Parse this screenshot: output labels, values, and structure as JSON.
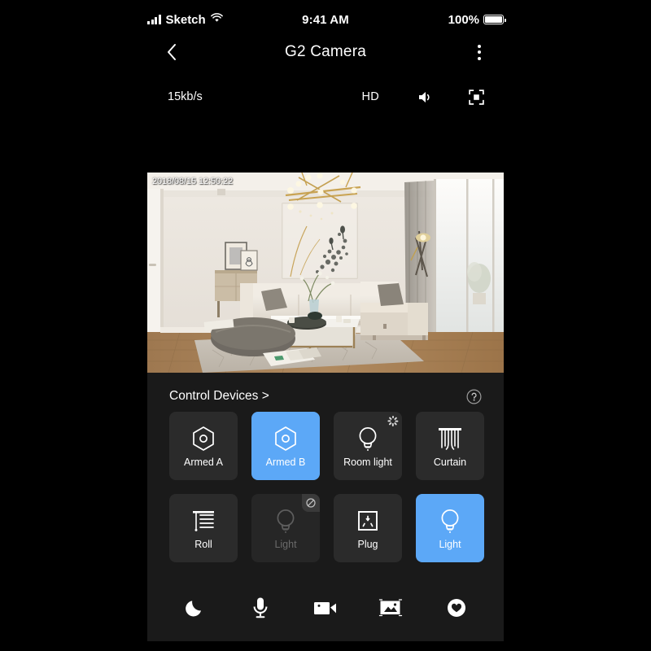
{
  "status_bar": {
    "carrier": "Sketch",
    "time": "9:41 AM",
    "battery_percent": "100%",
    "signal_icon": "signal-bars-icon",
    "wifi_icon": "wifi-icon",
    "battery_icon": "battery-full-icon"
  },
  "nav": {
    "back_icon": "chevron-left-icon",
    "title": "G2 Camera",
    "menu_icon": "more-vertical-icon"
  },
  "quality_bar": {
    "bitrate": "15kb/s",
    "quality": "HD",
    "speaker_icon": "speaker-on-icon",
    "fullscreen_icon": "fullscreen-icon"
  },
  "video": {
    "timestamp": "2018/08/15 12:50:22",
    "scene": "living-room"
  },
  "control_section": {
    "title": "Control Devices >",
    "help_icon": "help-circle-icon",
    "devices": [
      {
        "label": "Armed A",
        "icon": "shield-hexagon-icon",
        "state": "off",
        "badge": "none"
      },
      {
        "label": "Armed B",
        "icon": "shield-hexagon-icon",
        "state": "active",
        "badge": "none"
      },
      {
        "label": "Room light",
        "icon": "bulb-icon",
        "state": "off",
        "badge": "loading"
      },
      {
        "label": "Curtain",
        "icon": "curtain-icon",
        "state": "off",
        "badge": "none"
      },
      {
        "label": "Roll",
        "icon": "roller-blind-icon",
        "state": "off",
        "badge": "none"
      },
      {
        "label": "Light",
        "icon": "bulb-icon",
        "state": "disabled",
        "badge": "offline"
      },
      {
        "label": "Plug",
        "icon": "power-socket-icon",
        "state": "off",
        "badge": "none"
      },
      {
        "label": "Light",
        "icon": "bulb-icon",
        "state": "active",
        "badge": "none"
      }
    ]
  },
  "toolbar": {
    "items": [
      {
        "icon": "moon-icon",
        "name": "night-mode-button"
      },
      {
        "icon": "microphone-icon",
        "name": "talk-button"
      },
      {
        "icon": "video-camera-icon",
        "name": "record-button"
      },
      {
        "icon": "image-icon",
        "name": "snapshot-button"
      },
      {
        "icon": "heart-circle-icon",
        "name": "favorite-button"
      }
    ]
  },
  "colors": {
    "accent": "#5ca8f7",
    "panel_bg": "#1a1a1a",
    "tile_bg": "#2b2b2b",
    "screen_bg": "#000000"
  }
}
